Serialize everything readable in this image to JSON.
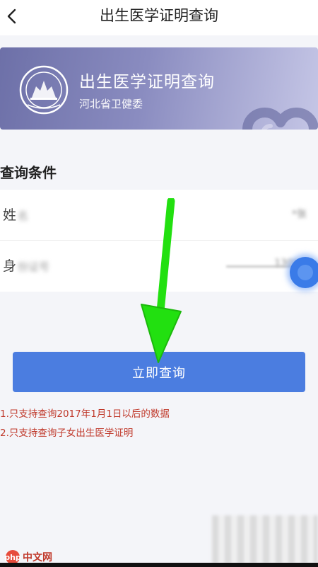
{
  "header": {
    "title": "出生医学证明查询"
  },
  "banner": {
    "title": "出生医学证明查询",
    "subtitle": "河北省卫健委"
  },
  "section": {
    "title": "查询条件"
  },
  "form": {
    "fields": [
      {
        "label": "姓",
        "label_rest": "名",
        "value": "*张"
      },
      {
        "label": "身",
        "label_rest": "份证号",
        "value": "130*"
      }
    ]
  },
  "actions": {
    "query_label": "立即查询"
  },
  "notes": [
    "1.只支持查询2017年1月1日以后的数据",
    "2.只支持查询子女出生医学证明"
  ],
  "watermark": {
    "text": "中文网",
    "logo": "php"
  },
  "colors": {
    "accent_button": "#4b7de0",
    "note_text": "#c0392b",
    "banner_start": "#6d70a8",
    "banner_end": "#c5c6e6",
    "arrow": "#22e010"
  },
  "icons": {
    "back": "chevron-left-icon",
    "emblem": "emblem-icon",
    "heart": "heart-icon",
    "arrow": "green-arrow-icon"
  }
}
